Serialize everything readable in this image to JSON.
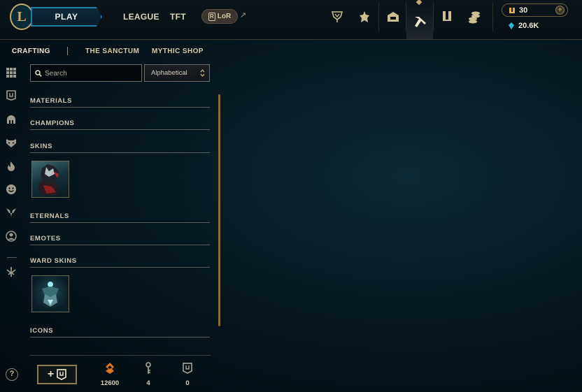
{
  "topbar": {
    "logo_letter": "L",
    "play_label": "PLAY",
    "nav": [
      "LEAGUE",
      "TFT"
    ],
    "lor_label": "LoR",
    "lor_arrow": "↗",
    "icons": [
      "worlds-trophy-icon",
      "ranked-emblem-icon",
      "store-chest-icon",
      "crafting-hammer-icon",
      "collection-book-icon",
      "loot-coins-icon"
    ],
    "wallet": {
      "rp": "30",
      "be": "20.6K",
      "plus": "+"
    }
  },
  "subnav": {
    "tabs": [
      "CRAFTING",
      "THE SANCTUM",
      "MYTHIC SHOP"
    ]
  },
  "sidebar_icons": [
    "grid-icon",
    "chest-icon",
    "helmet-icon",
    "mask-icon",
    "flame-icon",
    "emote-face-icon",
    "ward-icon",
    "profile-icon",
    "eternal-icon"
  ],
  "filter": {
    "search_placeholder": "Search",
    "sort_value": "Alphabetical"
  },
  "sections": [
    "MATERIALS",
    "CHAMPIONS",
    "SKINS",
    "ETERNALS",
    "EMOTES",
    "WARD SKINS",
    "ICONS"
  ],
  "footer": {
    "help": "?",
    "add_plus": "+",
    "counters": [
      {
        "icon": "orange-essence-icon",
        "value": "12600"
      },
      {
        "icon": "key-fragment-icon",
        "value": "4"
      },
      {
        "icon": "chest-icon",
        "value": "0"
      }
    ]
  },
  "colors": {
    "gold": "#c8aa6e",
    "play_border": "#1e7fa6",
    "essence_orange": "#e0771e",
    "blue_essence": "#2fb7d8"
  }
}
